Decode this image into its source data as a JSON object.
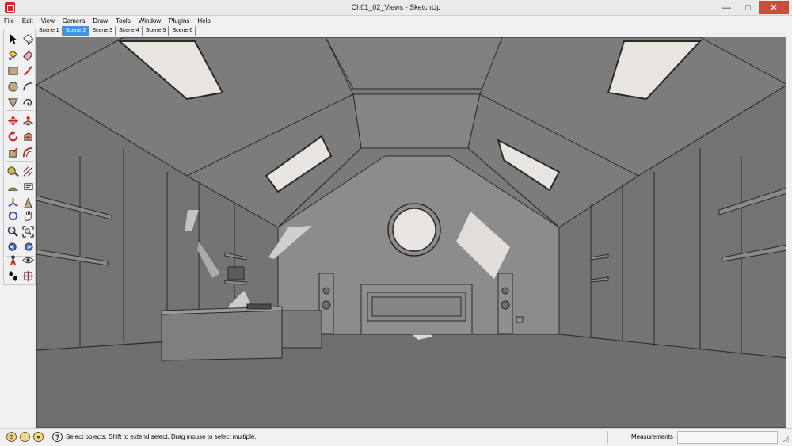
{
  "window": {
    "title": "Ch01_02_Views - SketchUp",
    "app_icon": "sketchup-logo-icon",
    "controls": [
      "minimize-icon",
      "maximize-icon",
      "close-icon"
    ]
  },
  "menu": [
    {
      "key": "file",
      "label": "File"
    },
    {
      "key": "edit",
      "label": "Edit"
    },
    {
      "key": "view",
      "label": "View"
    },
    {
      "key": "camera",
      "label": "Camera"
    },
    {
      "key": "draw",
      "label": "Draw"
    },
    {
      "key": "tools",
      "label": "Tools"
    },
    {
      "key": "window",
      "label": "Window"
    },
    {
      "key": "plugins",
      "label": "Plugins"
    },
    {
      "key": "help",
      "label": "Help"
    }
  ],
  "scenes": {
    "active": "Scene 2",
    "tabs": [
      "Scene 1",
      "Scene 2",
      "Scene 3",
      "Scene 4",
      "Scene 5",
      "Scene 6"
    ]
  },
  "toolbar": {
    "tools": [
      "select-icon",
      "eraser-icon",
      "paint-bucket-icon",
      "eraser-pink-icon",
      "rectangle-icon",
      "line-icon",
      "circle-icon",
      "arc-icon",
      "polygon-icon",
      "freehand-icon",
      "move-icon",
      "push-pull-icon",
      "rotate-icon",
      "follow-me-icon",
      "scale-icon",
      "offset-icon",
      "tape-measure-icon",
      "dimension-icon",
      "protractor-icon",
      "text-icon",
      "axes-icon",
      "3d-text-icon",
      "orbit-icon",
      "pan-icon",
      "zoom-icon",
      "zoom-extents-icon",
      "previous-view-icon",
      "next-view-icon",
      "position-camera-icon",
      "look-around-icon",
      "walk-icon",
      "section-plane-icon"
    ]
  },
  "status": {
    "icons": [
      "geo-location-icon",
      "credits-icon",
      "user-icon"
    ],
    "help_icon": "help-icon",
    "hint": "Select objects. Shift to extend select. Drag mouse to select multiple.",
    "measurements_label": "Measurements",
    "measurements_value": ""
  },
  "colors": {
    "active_scene_tab": "#3f93e6",
    "close_button": "#c7503c",
    "sketchup_red": "#d22222",
    "viewport_floor": "#6f6f6f",
    "viewport_walls": "#8a8a8a"
  }
}
